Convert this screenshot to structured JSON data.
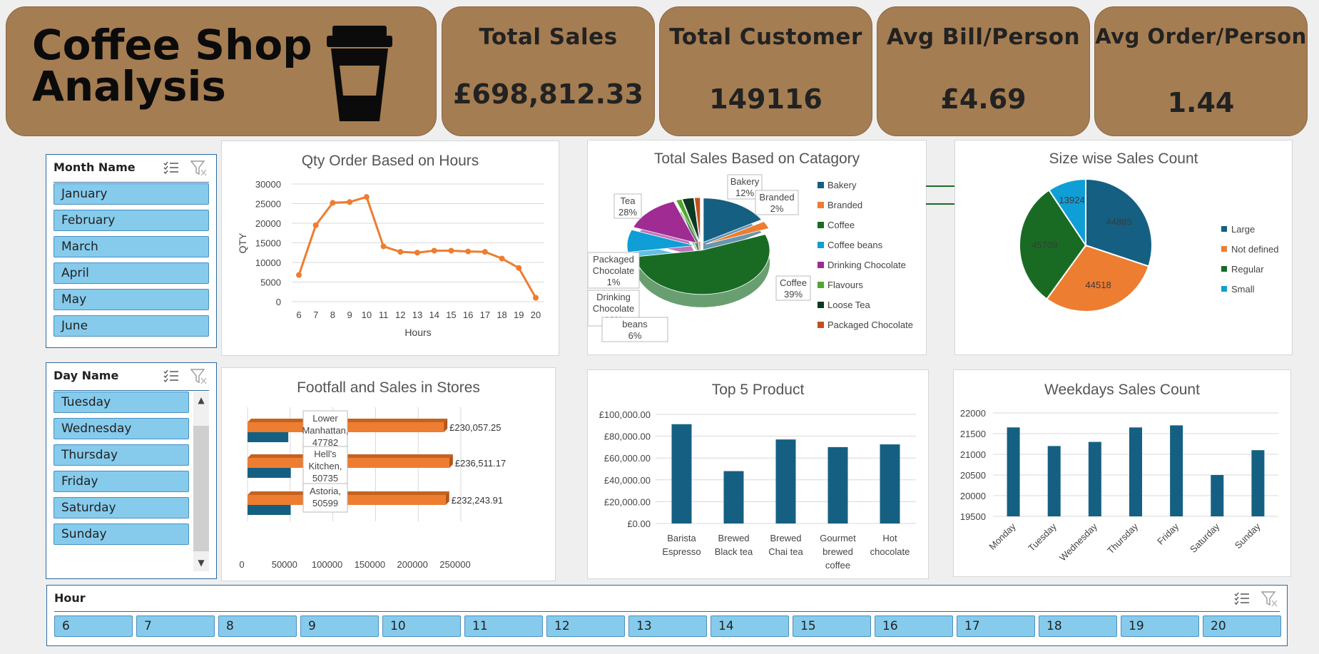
{
  "header": {
    "title_line1": "Coffee Shop",
    "title_line2": "Analysis",
    "icon": "coffee-cup-icon"
  },
  "kpis": [
    {
      "title": "Total Sales",
      "value": "£698,812.33"
    },
    {
      "title": "Total Customer",
      "value": "149116"
    },
    {
      "title": "Avg Bill/Person",
      "value": "£4.69"
    },
    {
      "title": "Avg Order/Person",
      "value": "1.44"
    }
  ],
  "slicers": {
    "month": {
      "title": "Month Name",
      "items": [
        "January",
        "February",
        "March",
        "April",
        "May",
        "June"
      ]
    },
    "day": {
      "title": "Day Name",
      "items": [
        "Tuesday",
        "Wednesday",
        "Thursday",
        "Friday",
        "Saturday",
        "Sunday"
      ]
    },
    "hour": {
      "title": "Hour",
      "items": [
        "6",
        "7",
        "8",
        "9",
        "10",
        "11",
        "12",
        "13",
        "14",
        "15",
        "16",
        "17",
        "18",
        "19",
        "20"
      ]
    }
  },
  "colors": {
    "card": "#a57d52",
    "orange": "#ed7d31",
    "blue": "#156082",
    "green": "#196b24",
    "cyan": "#0f9ed5",
    "slicer": "#86cbec"
  },
  "chart_data": [
    {
      "type": "line",
      "title": "Qty Order Based on Hours",
      "xlabel": "Hours",
      "ylabel": "QTY",
      "x": [
        6,
        7,
        8,
        9,
        10,
        11,
        12,
        13,
        14,
        15,
        16,
        17,
        18,
        19,
        20
      ],
      "values": [
        6800,
        19500,
        25200,
        25400,
        26700,
        14100,
        12700,
        12500,
        13000,
        13000,
        12800,
        12700,
        11000,
        8600,
        1000
      ],
      "ylim": [
        0,
        30000
      ],
      "yticks": [
        0,
        5000,
        10000,
        15000,
        20000,
        25000,
        30000
      ]
    },
    {
      "type": "pie",
      "title": "Total Sales Based on Catagory",
      "categories": [
        "Bakery",
        "Branded",
        "Coffee",
        "Coffee beans",
        "Drinking Chocolate",
        "Flavours",
        "Loose Tea",
        "Packaged Chocolate"
      ],
      "values": [
        12,
        2,
        39,
        6,
        10,
        1,
        2,
        1
      ],
      "tea_label": "Tea 28%",
      "labels": {
        "bakery": "Bakery 12%",
        "branded": "Branded 2%",
        "coffee": "Coffee 39%",
        "tea1": "Tea",
        "tea2": "28%",
        "pc1": "Packaged",
        "pc2": "Chocolate",
        "pc3": "1%",
        "dc1": "Drinking",
        "dc2": "Chocolate",
        "dc3": "10%",
        "cb1": "beans",
        "cb2": "6%"
      }
    },
    {
      "type": "pie",
      "title": "Size wise Sales Count",
      "categories": [
        "Large",
        "Not defined",
        "Regular",
        "Small"
      ],
      "values": [
        44885,
        44518,
        45709,
        13924
      ]
    },
    {
      "type": "bar",
      "title": "Footfall and Sales in Stores",
      "categories": [
        "Lower Manhattan",
        "Hell's Kitchen",
        "Astoria"
      ],
      "series": [
        {
          "name": "Sales",
          "values": [
            230057.25,
            236511.17,
            232243.91
          ],
          "labels": [
            "£230,057.25",
            "£236,511.17",
            "£232,243.91"
          ]
        },
        {
          "name": "Footfall",
          "values": [
            47782,
            50735,
            50599
          ]
        }
      ],
      "callouts": [
        [
          "Lower",
          "Manhattan,",
          "47782"
        ],
        [
          "Hell's",
          "Kitchen,",
          "50735"
        ],
        [
          "Astoria,",
          "50599"
        ]
      ],
      "xticks": [
        "0",
        "50000",
        "100000",
        "150000",
        "200000",
        "250000"
      ]
    },
    {
      "type": "bar",
      "title": "Top 5 Product",
      "categories": [
        "Barista Espresso",
        "Brewed Black tea",
        "Brewed Chai tea",
        "Gourmet brewed coffee",
        "Hot chocolate"
      ],
      "category_lines": [
        [
          "Barista",
          "Espresso"
        ],
        [
          "Brewed",
          "Black tea"
        ],
        [
          "Brewed",
          "Chai tea"
        ],
        [
          "Gourmet",
          "brewed",
          "coffee"
        ],
        [
          "Hot",
          "chocolate"
        ]
      ],
      "values": [
        91000,
        48000,
        77000,
        70000,
        72500
      ],
      "ylim": [
        0,
        100000
      ],
      "yticks": [
        "£0.00",
        "£20,000.00",
        "£40,000.00",
        "£60,000.00",
        "£80,000.00",
        "£100,000.00"
      ]
    },
    {
      "type": "bar",
      "title": "Weekdays Sales Count",
      "categories": [
        "Monday",
        "Tuesday",
        "Wednesday",
        "Thursday",
        "Friday",
        "Saturday",
        "Sunday"
      ],
      "values": [
        21650,
        21200,
        21300,
        21650,
        21700,
        20500,
        21100
      ],
      "ylim": [
        19500,
        22000
      ],
      "yticks": [
        "19500",
        "20000",
        "20500",
        "21000",
        "21500",
        "22000"
      ]
    }
  ]
}
